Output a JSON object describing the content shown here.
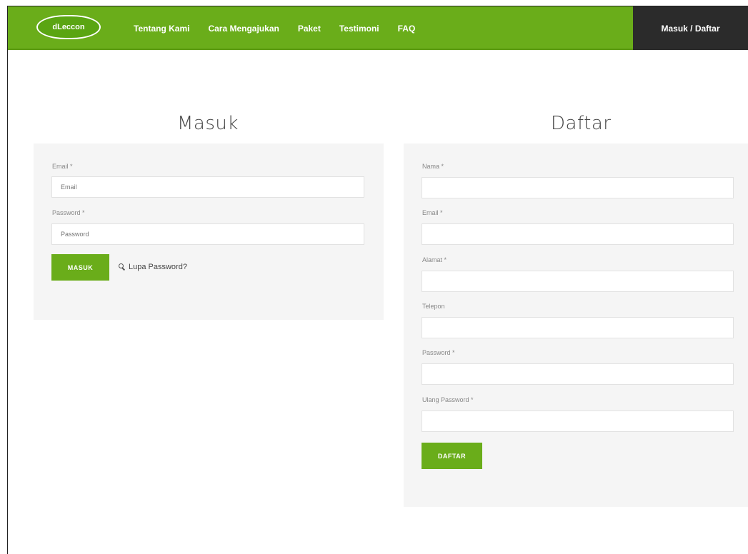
{
  "nav": {
    "logo": "dLeccon",
    "links": [
      "Tentang Kami",
      "Cara Mengajukan",
      "Paket",
      "Testimoni",
      "FAQ"
    ],
    "auth_tab": "Masuk / Daftar"
  },
  "login": {
    "title": "Masuk",
    "email_label": "Email *",
    "email_placeholder": "Email",
    "password_label": "Password *",
    "password_placeholder": "Password",
    "submit": "MASUK",
    "forgot": "Lupa Password?"
  },
  "register": {
    "title": "Daftar",
    "name_label": "Nama *",
    "email_label": "Email *",
    "address_label": "Alamat *",
    "phone_label": "Telepon",
    "password_label": "Password *",
    "repeat_label": "Ulang Password *",
    "submit": "DAFTAR"
  },
  "colors": {
    "brand_green": "#6aad1a",
    "dark_tab": "#2b2b2b",
    "panel_bg": "#f5f5f5"
  }
}
